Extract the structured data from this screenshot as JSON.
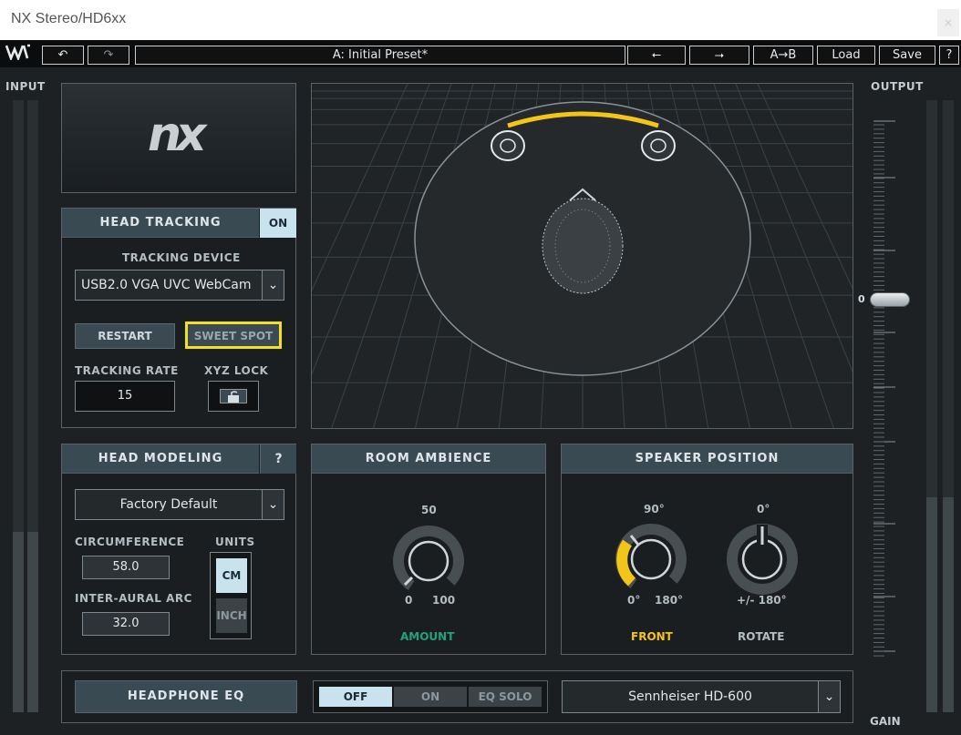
{
  "window": {
    "title": "NX Stereo/HD6xx",
    "close_glyph": "×"
  },
  "toolbar": {
    "logo": "W",
    "undo_glyph": "↶",
    "redo_glyph": "↷",
    "preset_name": "A: Initial Preset*",
    "prev_glyph": "⭠",
    "next_glyph": "⭢",
    "ab_label": "A→B",
    "load_label": "Load",
    "save_label": "Save",
    "help_label": "?"
  },
  "meters": {
    "input_label": "INPUT",
    "output_label": "OUTPUT",
    "gain_label": "GAIN",
    "gain_zero": "0"
  },
  "brand": {
    "logo_text": "nx"
  },
  "head_tracking": {
    "title": "HEAD TRACKING",
    "toggle_label": "ON",
    "device_label": "TRACKING DEVICE",
    "device_value": "USB2.0 VGA UVC WebCam",
    "restart_label": "RESTART",
    "sweet_spot_label": "SWEET SPOT",
    "rate_label": "TRACKING RATE",
    "rate_value": "15",
    "xyz_lock_label": "XYZ LOCK"
  },
  "head_modeling": {
    "title": "HEAD MODELING",
    "help_label": "?",
    "preset_value": "Factory Default",
    "circumference_label": "CIRCUMFERENCE",
    "circumference_value": "58.0",
    "units_label": "UNITS",
    "unit_cm": "CM",
    "unit_inch": "INCH",
    "inter_aural_label": "INTER-AURAL ARC",
    "inter_aural_value": "32.0"
  },
  "room_ambience": {
    "title": "ROOM AMBIENCE",
    "top_value": "50",
    "min_label": "0",
    "max_label": "100",
    "knob_label": "AMOUNT"
  },
  "speaker_position": {
    "title": "SPEAKER POSITION",
    "front_top": "90°",
    "front_min": "0°",
    "front_max": "180°",
    "front_label": "FRONT",
    "rotate_top": "0°",
    "rotate_range": "+/- 180°",
    "rotate_label": "ROTATE"
  },
  "headphone_eq": {
    "title": "HEADPHONE EQ",
    "off_label": "OFF",
    "on_label": "ON",
    "solo_label": "EQ SOLO",
    "model_value": "Sennheiser HD-600"
  },
  "colors": {
    "accent_yellow": "#f3c518",
    "accent_green": "#1fa37a",
    "panel_header": "#3a4a53",
    "highlight_blue": "#c9e3ee"
  }
}
